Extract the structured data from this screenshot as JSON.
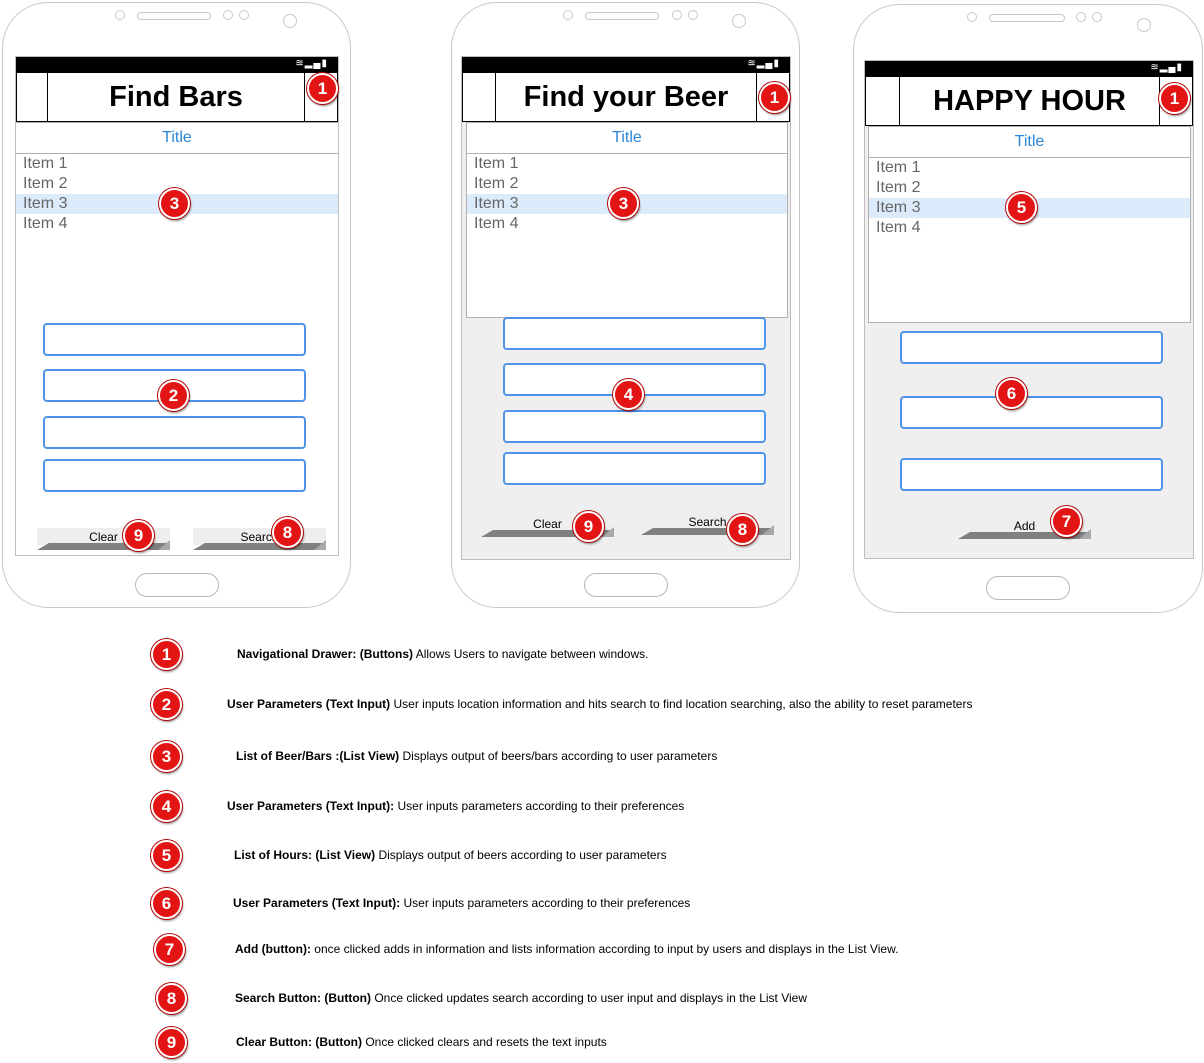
{
  "phones": [
    {
      "title": "Find Bars",
      "list_header": "Title",
      "items": [
        "Item 1",
        "Item 2",
        "Item 3",
        "Item 4"
      ],
      "selected_index": 2,
      "buttons": [
        "Clear",
        "Search"
      ],
      "badges": [
        "1",
        "3",
        "2",
        "9",
        "8"
      ]
    },
    {
      "title": "Find your Beer",
      "list_header": "Title",
      "items": [
        "Item 1",
        "Item 2",
        "Item 3",
        "Item 4"
      ],
      "selected_index": 2,
      "buttons": [
        "Clear",
        "Search"
      ],
      "badges": [
        "1",
        "3",
        "4",
        "9",
        "8"
      ]
    },
    {
      "title": "HAPPY HOUR",
      "list_header": "Title",
      "items": [
        "Item 1",
        "Item 2",
        "Item 3",
        "Item 4"
      ],
      "selected_index": 2,
      "buttons": [
        "Add"
      ],
      "badges": [
        "1",
        "5",
        "6",
        "7"
      ]
    }
  ],
  "status_icons": "wifi-signal-battery",
  "legend": [
    {
      "num": "1",
      "term": "Navigational Drawer: (Buttons)",
      "desc": " Allows Users to navigate between windows."
    },
    {
      "num": "2",
      "term": "User Parameters (Text Input)",
      "desc": " User inputs location information and hits search to find location searching, also the ability to reset parameters"
    },
    {
      "num": "3",
      "term": "List of Beer/Bars :(List View)",
      "desc": " Displays output of beers/bars according to user parameters"
    },
    {
      "num": "4",
      "term": "User Parameters (Text Input):",
      "desc": " User inputs parameters according to their preferences"
    },
    {
      "num": "5",
      "term": "List of Hours: (List View)",
      "desc": " Displays output of beers according to user parameters"
    },
    {
      "num": "6",
      "term": "User Parameters (Text Input):",
      "desc": " User inputs parameters according to their preferences"
    },
    {
      "num": "7",
      "term": "Add (button):",
      "desc": " once clicked adds in information and lists information according to input by users and displays in the List View."
    },
    {
      "num": "8",
      "term": "Search Button: (Button)",
      "desc": " Once clicked updates search according to user input and displays in the List View"
    },
    {
      "num": "9",
      "term": "Clear Button: (Button)",
      "desc": " Once clicked clears and resets the text inputs"
    }
  ],
  "colors": {
    "badge": "#e21414",
    "list_header_text": "#2b87d8",
    "selected_row": "#dcebfb",
    "input_border": "#4f94e6"
  }
}
